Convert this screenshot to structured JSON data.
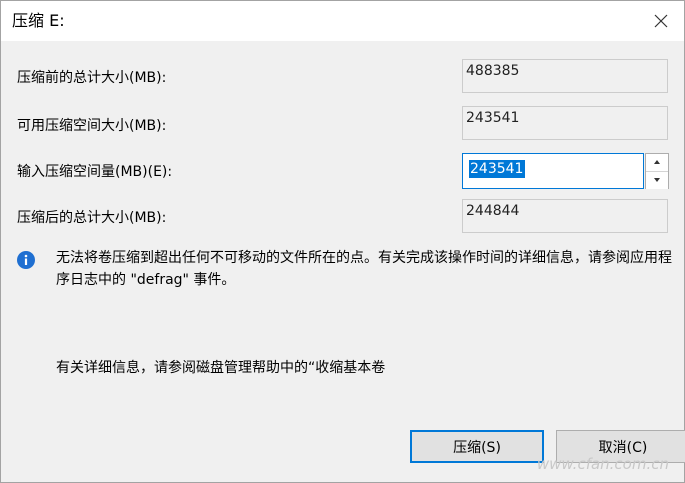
{
  "window": {
    "title": "压缩 E:",
    "close_icon": "close-icon"
  },
  "fields": {
    "total_before_label": "压缩前的总计大小(MB):",
    "total_before_value": "488385",
    "available_label": "可用压缩空间大小(MB):",
    "available_value": "243541",
    "amount_label": "输入压缩空间量(MB)(E):",
    "amount_value": "243541",
    "total_after_label": "压缩后的总计大小(MB):",
    "total_after_value": "244844"
  },
  "info": {
    "icon": "info-icon",
    "message": "无法将卷压缩到超出任何不可移动的文件所在的点。有关完成该操作时间的详细信息，请参阅应用程序日志中的 \"defrag\" 事件。"
  },
  "help": {
    "text": "有关详细信息，请参阅磁盘管理帮助中的“收缩基本卷"
  },
  "buttons": {
    "shrink_label": "压缩(S)",
    "cancel_label": "取消(C)"
  },
  "watermark": {
    "text": "www.cfan.com.cn"
  },
  "colors": {
    "accent": "#0078d7",
    "content_background": "#f0f0f0",
    "button_background": "#e1e1e1"
  }
}
